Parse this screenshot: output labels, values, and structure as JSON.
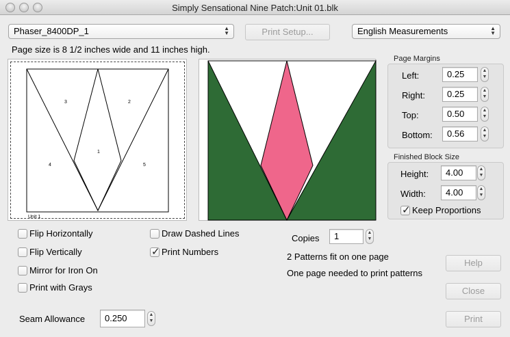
{
  "window": {
    "title": "Simply Sensational Nine Patch:Unit 01.blk"
  },
  "printer": {
    "selected": "Phaser_8400DP_1"
  },
  "print_setup_label": "Print Setup...",
  "measurements": {
    "selected": "English Measurements"
  },
  "page_size_text": "Page size is 8 1/2 inches wide and 11 inches high.",
  "pattern": {
    "unit_label": "Unit 1",
    "section_numbers": [
      "1",
      "2",
      "3",
      "4",
      "5"
    ]
  },
  "colors": {
    "green": "#2e6b35",
    "pink": "#ef668b"
  },
  "page_margins": {
    "title": "Page Margins",
    "left_label": "Left:",
    "left_value": "0.25",
    "right_label": "Right:",
    "right_value": "0.25",
    "top_label": "Top:",
    "top_value": "0.50",
    "bottom_label": "Bottom:",
    "bottom_value": "0.56"
  },
  "finished_block": {
    "title": "Finished Block Size",
    "height_label": "Height:",
    "height_value": "4.00",
    "width_label": "Width:",
    "width_value": "4.00",
    "keep_proportions_label": "Keep Proportions",
    "keep_proportions_checked": true
  },
  "options": {
    "flip_horizontally": "Flip Horizontally",
    "flip_vertically": "Flip Vertically",
    "mirror_iron_on": "Mirror for Iron On",
    "print_grays": "Print with Grays",
    "draw_dashed": "Draw Dashed Lines",
    "print_numbers": "Print Numbers",
    "print_numbers_checked": true
  },
  "copies": {
    "label": "Copies",
    "value": "1"
  },
  "info": {
    "patterns_fit": "2 Patterns fit on one page",
    "pages_needed": "One page needed to print patterns"
  },
  "seam_allowance": {
    "label": "Seam Allowance",
    "value": "0.250"
  },
  "buttons": {
    "help": "Help",
    "close": "Close",
    "print": "Print"
  }
}
